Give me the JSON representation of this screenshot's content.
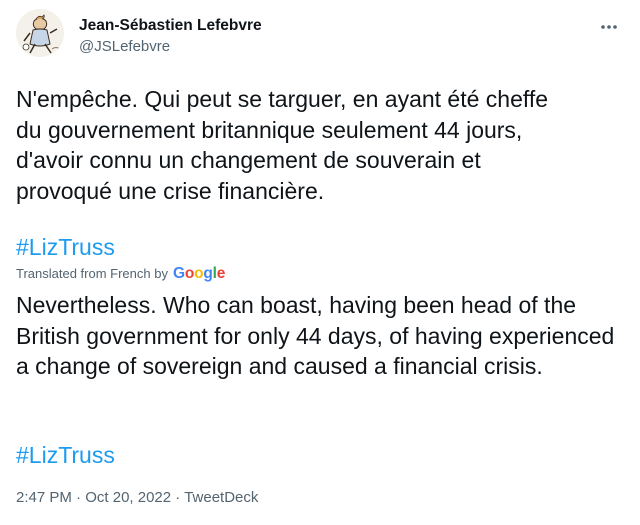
{
  "author": {
    "display_name": "Jean-Sébastien Lefebvre",
    "handle": "@JSLefebvre",
    "avatar_icon": "avatar-illustration-icon"
  },
  "more_icon": "more-horizontal-icon",
  "tweet": {
    "text": "N'empêche. Qui peut se targuer, en ayant été cheffe\ndu gouvernement britannique seulement 44 jours,\nd'avoir connu un changement de souverain et\nprovoqué une crise financière.",
    "hashtag": "#LizTruss"
  },
  "translation": {
    "label": "Translated from French by",
    "provider": "Google",
    "text": "Nevertheless. Who can boast, having been head of the British government for only 44 days, of having experienced a change of sovereign and caused a financial crisis.",
    "hashtag": "#LizTruss"
  },
  "meta": {
    "time": "2:47 PM",
    "separator": "·",
    "date": "Oct 20, 2022",
    "source": "TweetDeck"
  },
  "colors": {
    "link": "#1d9bf0",
    "secondary_text": "#536471",
    "primary_text": "#0f1419"
  }
}
